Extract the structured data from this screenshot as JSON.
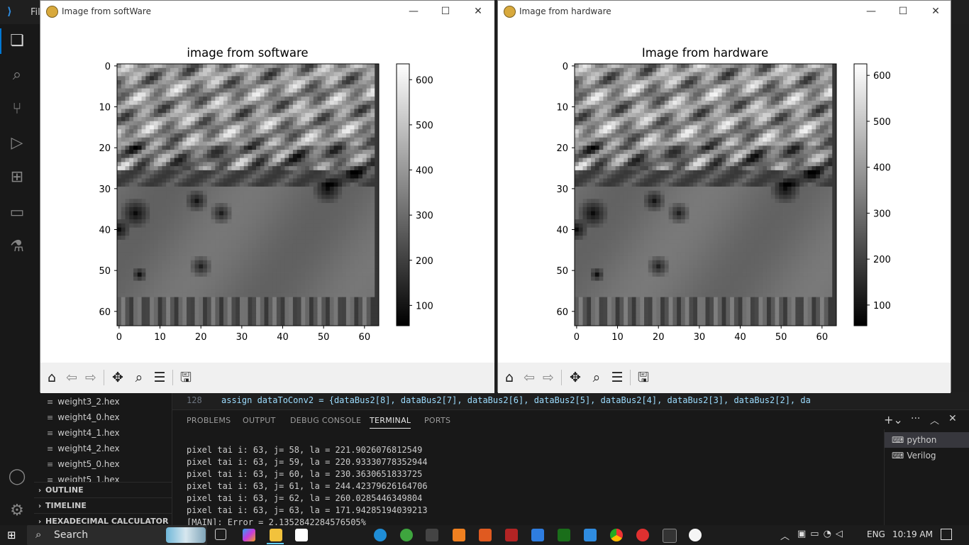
{
  "vscode": {
    "menu_label": "Fil",
    "editor_line": {
      "number": "128",
      "code": "assign dataToConv2 = {dataBus2[8], dataBus2[7], dataBus2[6], dataBus2[5], dataBus2[4], dataBus2[3], dataBus2[2], da"
    },
    "files": [
      "weight3_2.hex",
      "weight4_0.hex",
      "weight4_1.hex",
      "weight4_2.hex",
      "weight5_0.hex",
      "weight5_1.hex"
    ],
    "sections": [
      "OUTLINE",
      "TIMELINE",
      "HEXADECIMAL CALCULATOR"
    ],
    "panel_tabs": [
      "PROBLEMS",
      "OUTPUT",
      "DEBUG CONSOLE",
      "TERMINAL",
      "PORTS"
    ],
    "active_tab": "TERMINAL",
    "terminal_lines": [
      "pixel tai i: 63, j= 58, la = 221.9026076812549",
      "pixel tai i: 63, j= 59, la = 220.93330778352944",
      "pixel tai i: 63, j= 60, la = 230.3630651833725",
      "pixel tai i: 63, j= 61, la = 244.42379626164706",
      "pixel tai i: 63, j= 62, la = 260.0285446349804",
      "pixel tai i: 63, j= 63, la = 171.94285194039213",
      "[MAIN]: Error = 2.1352842284576505%"
    ],
    "terminals": [
      "python",
      "Verilog"
    ]
  },
  "windows": [
    {
      "title": "Image from softWare",
      "plot_title": "image from software"
    },
    {
      "title": "Image from hardware",
      "plot_title": "Image from hardware"
    }
  ],
  "chart_data": [
    {
      "type": "heatmap",
      "title": "image from software",
      "xlabel": "",
      "ylabel": "",
      "xticks": [
        0,
        10,
        20,
        30,
        40,
        50,
        60
      ],
      "yticks": [
        0,
        10,
        20,
        30,
        40,
        50,
        60
      ],
      "xlim": [
        -0.5,
        63.5
      ],
      "ylim": [
        63.5,
        -0.5
      ],
      "grid_size": [
        64,
        64
      ],
      "colormap": "gray",
      "colorbar_ticks": [
        100,
        200,
        300,
        400,
        500,
        600
      ],
      "value_range": [
        55,
        635
      ]
    },
    {
      "type": "heatmap",
      "title": "Image from hardware",
      "xlabel": "",
      "ylabel": "",
      "xticks": [
        0,
        10,
        20,
        30,
        40,
        50,
        60
      ],
      "yticks": [
        0,
        10,
        20,
        30,
        40,
        50,
        60
      ],
      "xlim": [
        -0.5,
        63.5
      ],
      "ylim": [
        63.5,
        -0.5
      ],
      "grid_size": [
        64,
        64
      ],
      "colormap": "gray",
      "colorbar_ticks": [
        100,
        200,
        300,
        400,
        500,
        600
      ],
      "value_range": [
        55,
        625
      ]
    }
  ],
  "taskbar": {
    "search_placeholder": "Search",
    "language": "ENG",
    "time": "10:19 AM"
  },
  "icons": {
    "home": "home-icon",
    "back": "arrow-left-icon",
    "forward": "arrow-right-icon",
    "pan": "move-icon",
    "zoom": "magnifier-icon",
    "configure": "sliders-icon",
    "save": "floppy-icon"
  }
}
